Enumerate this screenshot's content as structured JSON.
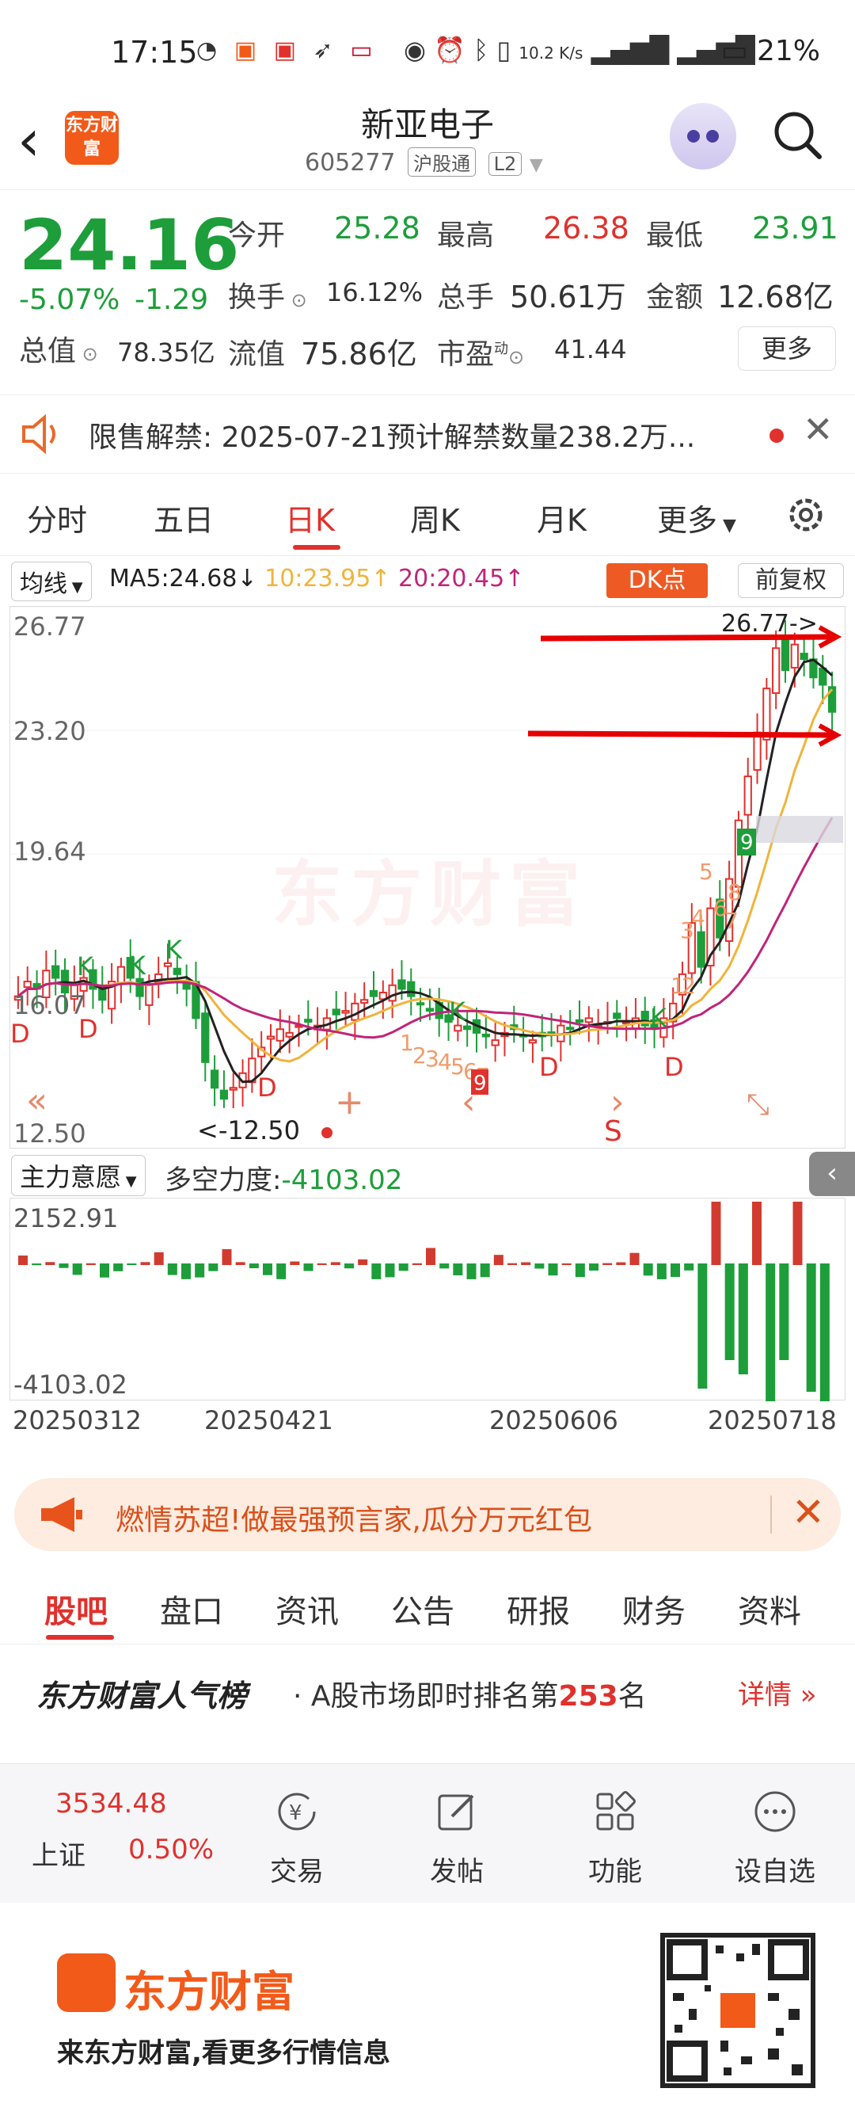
{
  "status_bar": {
    "time": "17:15",
    "icons": [
      "wechat-icon",
      "taobao-icon",
      "app-icon",
      "feather-icon",
      "app-icon"
    ],
    "speed": "10.2 K/s",
    "battery": "21%"
  },
  "header": {
    "logo_text": "东方财富",
    "stock_name": "新亚电子",
    "stock_code": "605277",
    "tag_connect": "沪股通",
    "tag_level": "L2"
  },
  "quote": {
    "price": "24.16",
    "change_pct": "-5.07%",
    "change": "-1.29",
    "open_label": "今开",
    "open": "25.28",
    "high_label": "最高",
    "high": "26.38",
    "low_label": "最低",
    "low": "23.91",
    "turnover_label": "换手",
    "turnover": "16.12%",
    "volume_label": "总手",
    "volume": "50.61万",
    "amount_label": "金额",
    "amount": "12.68亿",
    "mcap_label": "总值",
    "mcap": "78.35亿",
    "float_label": "流值",
    "float": "75.86亿",
    "pe_label": "市盈",
    "pe_sup": "动",
    "pe": "41.44",
    "more": "更多"
  },
  "notice": {
    "label": "限售解禁:",
    "text": "2025-07-21预计解禁数量238.2万..."
  },
  "period_tabs": [
    "分时",
    "五日",
    "日K",
    "周K",
    "月K",
    "更多"
  ],
  "indicator": {
    "selector": "均线",
    "ma5": "MA5:24.68",
    "ma10": "10:23.95",
    "ma20": "20:20.45",
    "dk": "DK点",
    "fuquan": "前复权"
  },
  "kchart": {
    "y_labels": [
      "26.77",
      "23.20",
      "19.64",
      "16.07",
      "12.50"
    ],
    "high_note": "26.77->",
    "low_note": "<-12.50",
    "watermark": "东方财富",
    "colors": {
      "up": "#e0312d",
      "down": "#1d9e3a",
      "ma5": "#222222",
      "ma10": "#f0b43c",
      "ma20": "#c0247a"
    }
  },
  "sub": {
    "selector": "主力意愿",
    "label": "多空力度:",
    "value": "-4103.02",
    "top": "2152.91",
    "bottom": "-4103.02",
    "dates": [
      "20250312",
      "20250421",
      "20250606",
      "20250718"
    ]
  },
  "promo": {
    "text": "燃情苏超!做最强预言家,瓜分万元红包"
  },
  "bottom_tabs": [
    "股吧",
    "盘口",
    "资讯",
    "公告",
    "研报",
    "财务",
    "资料"
  ],
  "popularity": {
    "brand": "东方财富人气榜",
    "desc_prefix": "· A股市场即时排名第",
    "rank": "253",
    "desc_suffix": "名",
    "detail": "详情"
  },
  "dock": {
    "index_value": "3534.48",
    "index_name": "上证",
    "index_pct": "0.50%",
    "items": [
      "交易",
      "发帖",
      "功能",
      "设自选"
    ]
  },
  "footer": {
    "brand": "东方财富",
    "slogan": "来东方财富,看更多行情信息"
  }
}
